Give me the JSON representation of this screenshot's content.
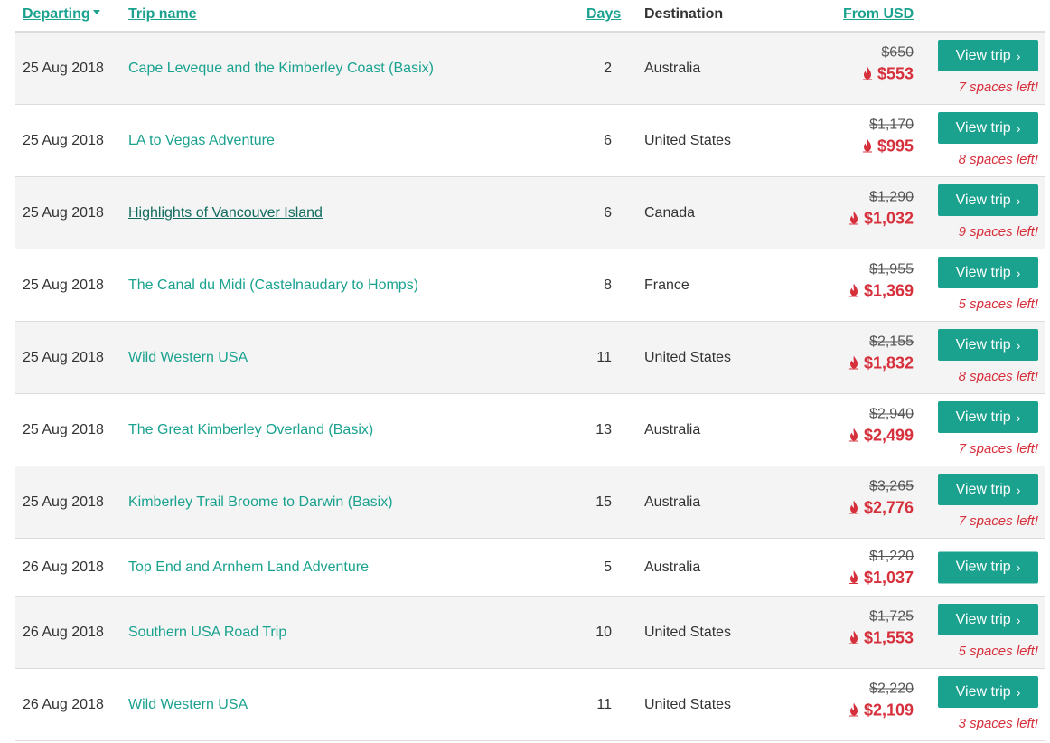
{
  "headers": {
    "departing": "Departing",
    "trip_name": "Trip name",
    "days": "Days",
    "destination": "Destination",
    "from_usd": "From USD"
  },
  "icons": {
    "sort": "caret-down-icon",
    "price": "flame-icon",
    "button": "chevron-right-icon"
  },
  "colors": {
    "accent": "#1aa28f",
    "sale": "#d6303c",
    "row_alt": "#f4f4f4"
  },
  "button_label": "View trip",
  "rows": [
    {
      "date": "25 Aug 2018",
      "name": "Cape Leveque and the Kimberley Coast (Basix)",
      "days": "2",
      "destination": "Australia",
      "old_price": "$650",
      "new_price": "$553",
      "spaces": "7 spaces left!"
    },
    {
      "date": "25 Aug 2018",
      "name": "LA to Vegas Adventure",
      "days": "6",
      "destination": "United States",
      "old_price": "$1,170",
      "new_price": "$995",
      "spaces": "8 spaces left!"
    },
    {
      "date": "25 Aug 2018",
      "name": "Highlights of Vancouver Island",
      "days": "6",
      "destination": "Canada",
      "old_price": "$1,290",
      "new_price": "$1,032",
      "spaces": "9 spaces left!"
    },
    {
      "date": "25 Aug 2018",
      "name": "The Canal du Midi (Castelnaudary to Homps)",
      "days": "8",
      "destination": "France",
      "old_price": "$1,955",
      "new_price": "$1,369",
      "spaces": "5 spaces left!"
    },
    {
      "date": "25 Aug 2018",
      "name": "Wild Western USA",
      "days": "11",
      "destination": "United States",
      "old_price": "$2,155",
      "new_price": "$1,832",
      "spaces": "8 spaces left!"
    },
    {
      "date": "25 Aug 2018",
      "name": "The Great Kimberley Overland (Basix)",
      "days": "13",
      "destination": "Australia",
      "old_price": "$2,940",
      "new_price": "$2,499",
      "spaces": "7 spaces left!"
    },
    {
      "date": "25 Aug 2018",
      "name": "Kimberley Trail Broome to Darwin (Basix)",
      "days": "15",
      "destination": "Australia",
      "old_price": "$3,265",
      "new_price": "$2,776",
      "spaces": "7 spaces left!"
    },
    {
      "date": "26 Aug 2018",
      "name": "Top End and Arnhem Land Adventure",
      "days": "5",
      "destination": "Australia",
      "old_price": "$1,220",
      "new_price": "$1,037",
      "spaces": ""
    },
    {
      "date": "26 Aug 2018",
      "name": "Southern USA Road Trip",
      "days": "10",
      "destination": "United States",
      "old_price": "$1,725",
      "new_price": "$1,553",
      "spaces": "5 spaces left!"
    },
    {
      "date": "26 Aug 2018",
      "name": "Wild Western USA",
      "days": "11",
      "destination": "United States",
      "old_price": "$2,220",
      "new_price": "$2,109",
      "spaces": "3 spaces left!"
    }
  ]
}
